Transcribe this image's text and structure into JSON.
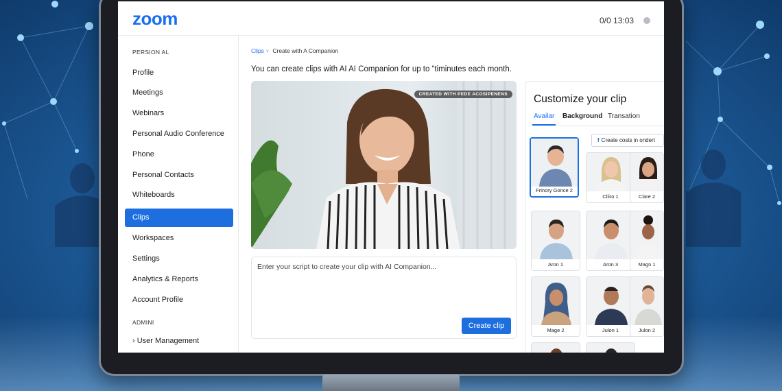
{
  "app": {
    "logo": "zoom",
    "clock": "0/0 13:03"
  },
  "sidebar": {
    "section_personal": "PERSION AL",
    "items": [
      {
        "label": "Profile"
      },
      {
        "label": "Meetings"
      },
      {
        "label": "Webinars"
      },
      {
        "label": "Personal Audio Conference"
      },
      {
        "label": "Phone"
      },
      {
        "label": "Personal Contacts"
      },
      {
        "label": "Whiteboards"
      },
      {
        "label": "Clips",
        "active": true
      },
      {
        "label": "Workspaces"
      },
      {
        "label": "Settings"
      },
      {
        "label": "Analytics & Reports"
      },
      {
        "label": "Account Profile"
      }
    ],
    "section_admin": "ADMINI",
    "admin_item": "User Management"
  },
  "main": {
    "breadcrumb": {
      "root": "Clips",
      "current": "Create with A Companion"
    },
    "intro": "You can create clips with AI AI Companion for up to “timinutes each month.",
    "video_tag": "CREATED WITH PEDE ACOSIPENENS",
    "script_placeholder": "Enter your script to create your clip with AI Companion...",
    "create_button": "Create clip"
  },
  "panel": {
    "title": "Customize your clip",
    "tabs": [
      "Availar",
      "Background",
      "Transation"
    ],
    "active_tab": "Availar",
    "costs_button": "Create costs in ondert",
    "avatars": [
      {
        "name": "Frinory Gonce 2",
        "selected": true
      },
      {
        "name": "Cliiro 1"
      },
      {
        "name": "Clare 2"
      },
      {
        "name": "Aron 1"
      },
      {
        "name": "Aron 3"
      },
      {
        "name": "Magn 1"
      },
      {
        "name": "Mage 2"
      },
      {
        "name": "Julon 1"
      },
      {
        "name": "Julon 2"
      }
    ]
  },
  "colors": {
    "accent": "#1d6fe0",
    "brand": "#1a6ef2",
    "background_blue": "#1f5f9e"
  },
  "icons": [
    "chevron-down-icon",
    "facebook-icon",
    "chevron-right-icon",
    "status-dot-icon"
  ]
}
